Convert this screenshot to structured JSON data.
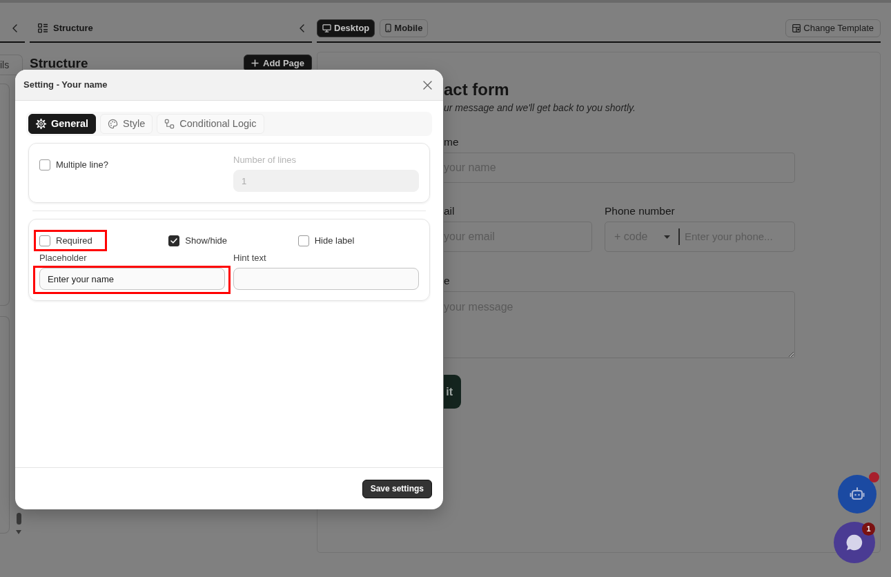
{
  "left_panel": {
    "tab_label": "ils"
  },
  "structure_panel": {
    "header_title": "Structure",
    "heading": "Structure",
    "add_button": "Add Page"
  },
  "preview": {
    "view_tabs": [
      {
        "kind": "desktop",
        "label": "Desktop",
        "selected": true
      },
      {
        "kind": "mobile",
        "label": "Mobile",
        "selected": false
      }
    ],
    "change_template_button": "Change Template",
    "form": {
      "title": "act form",
      "subtitle": "ur message and we'll get back to you shortly.",
      "rows": [
        {
          "fields": [
            {
              "kind": "text",
              "label": "me",
              "placeholder": "your name"
            }
          ]
        },
        {
          "fields": [
            {
              "kind": "text",
              "label": "ail",
              "placeholder": "your email"
            },
            {
              "kind": "phone",
              "label": "Phone number",
              "code_placeholder": "+ code",
              "placeholder": "Enter your phone..."
            }
          ]
        },
        {
          "fields": [
            {
              "kind": "textarea",
              "label": "e",
              "placeholder": "your message"
            }
          ]
        }
      ],
      "submit_button": "it"
    }
  },
  "modal": {
    "title": "Setting - Your name",
    "tabs": [
      {
        "kind": "general",
        "label": "General",
        "selected": true
      },
      {
        "kind": "style",
        "label": "Style",
        "selected": false
      },
      {
        "kind": "logic",
        "label": "Conditional Logic",
        "selected": false
      }
    ],
    "sections": [
      {
        "rows": [
          [
            {
              "kind": "checkbox",
              "label": "Multiple line?",
              "checked": false,
              "disabled": false,
              "highlighted": false
            },
            {
              "kind": "input",
              "label": "Number of lines",
              "value": "1",
              "disabled": true,
              "highlighted": false
            }
          ]
        ]
      },
      {
        "rows": [
          [
            {
              "kind": "checkbox",
              "label": "Required",
              "checked": false,
              "disabled": false,
              "highlighted": true
            },
            {
              "kind": "checkbox",
              "label": "Show/hide",
              "checked": true,
              "disabled": false,
              "highlighted": false
            },
            {
              "kind": "checkbox",
              "label": "Hide label",
              "checked": false,
              "disabled": false,
              "highlighted": false
            }
          ],
          [
            {
              "kind": "input",
              "label": "Placeholder",
              "value": "Enter your name",
              "disabled": false,
              "highlighted": true
            },
            {
              "kind": "input",
              "label": "Hint text",
              "disabled": false,
              "highlighted": false
            }
          ]
        ]
      }
    ],
    "save_button": "Save settings"
  },
  "assistant_button": {
    "notification_dot": true
  },
  "chat_button": {
    "badge": "1"
  }
}
